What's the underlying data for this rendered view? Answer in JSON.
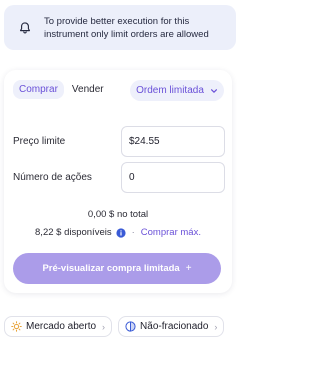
{
  "notice": {
    "icon": "bell-icon",
    "text": "To provide better execution for this instrument only limit orders are allowed"
  },
  "trade": {
    "tabs": [
      {
        "label": "Comprar",
        "active": true
      },
      {
        "label": "Vender",
        "active": false
      }
    ],
    "order_type": "Ordem limitada",
    "fields": {
      "limit_price": {
        "label": "Preço limite",
        "value": "$24.55"
      },
      "shares": {
        "label": "Número de ações",
        "value": "0"
      }
    },
    "total": "0,00 $ no total",
    "available": "8,22 $ disponíveis",
    "separator": "·",
    "buy_max": "Comprar máx.",
    "preview_button": "Pré-visualizar compra limitada",
    "preview_button_icon": "+"
  },
  "chips": [
    {
      "label": "Mercado aberto",
      "icon": "sun-icon"
    },
    {
      "label": "Não-fracionado",
      "icon": "no-fraction-icon"
    }
  ],
  "colors": {
    "accent": "#6a51d8",
    "accent_bg": "#eef0fb",
    "button_bg": "#ab9ce9",
    "notice_bg": "#eceffa",
    "info_icon": "#3a5bd6",
    "sun_icon": "#e8a33a"
  }
}
